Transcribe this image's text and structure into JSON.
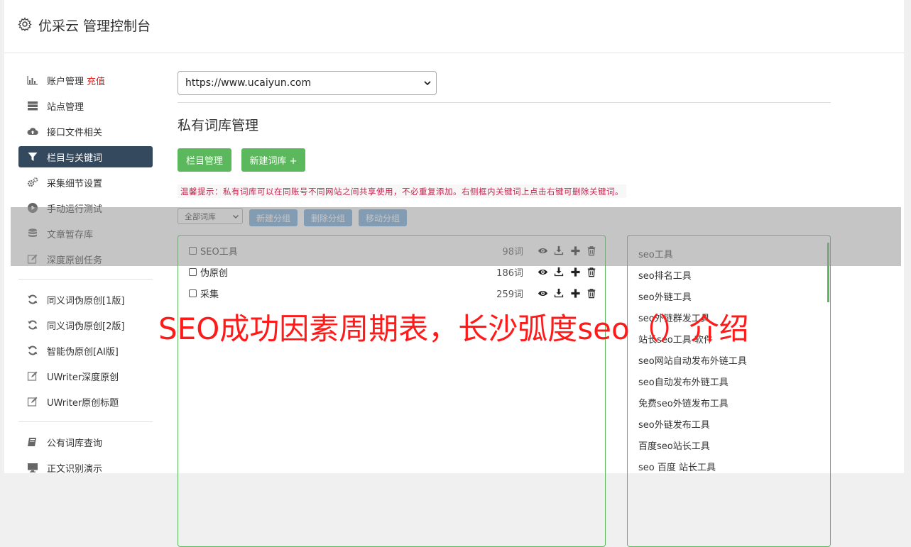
{
  "header": {
    "title": "优采云 管理控制台",
    "icon": "gear-icon"
  },
  "sidebar": {
    "group1": [
      {
        "label": "账户管理",
        "badge": "充值",
        "icon": "bar-chart-icon"
      },
      {
        "label": "站点管理",
        "icon": "server-icon"
      },
      {
        "label": "接口文件相关",
        "icon": "cloud-upload-icon"
      },
      {
        "label": "栏目与关键词",
        "icon": "filter-icon",
        "active": true
      },
      {
        "label": "采集细节设置",
        "icon": "gears-icon"
      },
      {
        "label": "手动运行测试",
        "icon": "play-circle-icon"
      },
      {
        "label": "文章暂存库",
        "icon": "database-icon"
      },
      {
        "label": "深度原创任务",
        "icon": "edit-icon"
      }
    ],
    "group2": [
      {
        "label": "同义词伪原创[1版]",
        "icon": "refresh-icon"
      },
      {
        "label": "同义词伪原创[2版]",
        "icon": "refresh-icon"
      },
      {
        "label": "智能伪原创[AI版]",
        "icon": "refresh-icon"
      },
      {
        "label": "UWriter深度原创",
        "icon": "edit-icon"
      },
      {
        "label": "UWriter原创标题",
        "icon": "edit-icon"
      }
    ],
    "group3": [
      {
        "label": "公有词库查询",
        "icon": "book-icon"
      },
      {
        "label": "正文识别演示",
        "icon": "monitor-icon"
      }
    ]
  },
  "main": {
    "site_select": "https://www.ucaiyun.com",
    "section_title": "私有词库管理",
    "btn_column": "栏目管理",
    "btn_new_lib": "新建词库 +",
    "tip": "温馨提示：私有词库可以在同账号不同网站之间共享使用，不必重复添加。右侧框内关键词上点击右键可删除关键词。",
    "group_select": "全部词库",
    "btn_new_group": "新建分组",
    "btn_delete_group": "删除分组",
    "btn_move_group": "移动分组",
    "libraries": [
      {
        "name": "SEO工具",
        "count": "98词"
      },
      {
        "name": "伪原创",
        "count": "186词"
      },
      {
        "name": "采集",
        "count": "259词"
      }
    ],
    "keywords": [
      "seo工具",
      "seo排名工具",
      "seo外链工具",
      "seo外链群发工具",
      "站长seo工具 软件",
      "seo网站自动发布外链工具",
      "seo自动发布外链工具",
      "免费seo外链发布工具",
      "seo外链发布工具",
      "百度seo站长工具",
      "seo 百度 站长工具"
    ]
  },
  "watermark": "SEO成功因素周期表，长沙弧度seo（）介绍",
  "colors": {
    "green": "#5cb85c",
    "active_nav": "#34495e",
    "blue_btn": "#5b9bd5",
    "tip_text": "#c7254e",
    "watermark": "#ff1a1a"
  }
}
